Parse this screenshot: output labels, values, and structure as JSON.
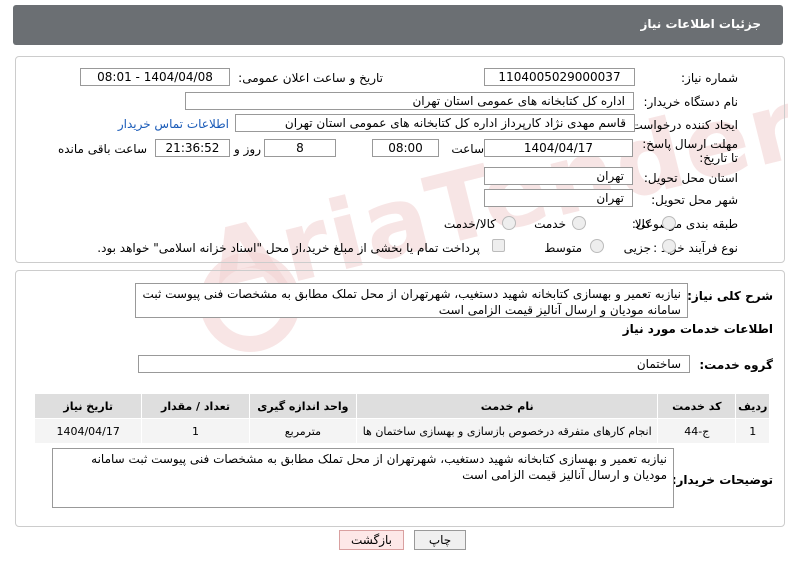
{
  "header": {
    "title": "جزئیات اطلاعات نیاز"
  },
  "form": {
    "need_number_label": "شماره نیاز:",
    "need_number": "1104005029000037",
    "announce_datetime_label": "تاریخ و ساعت اعلان عمومی:",
    "announce_datetime": "1404/04/08 - 08:01",
    "buyer_org_label": "نام دستگاه خریدار:",
    "buyer_org": "اداره کل کتابخانه های عمومی استان تهران",
    "requester_label": "ایجاد کننده درخواست:",
    "requester": "قاسم مهدی نژاد کارپرداز اداره کل کتابخانه های عمومی استان تهران",
    "buyer_contact_link": "اطلاعات تماس خریدار",
    "deadline_label": "مهلت ارسال پاسخ: تا تاریخ:",
    "deadline_date": "1404/04/17",
    "time_label": "ساعت",
    "deadline_time": "08:00",
    "days_value": "8",
    "days_label": "روز و",
    "remaining_time": "21:36:52",
    "remaining_label": "ساعت باقی مانده",
    "province_label": "استان محل تحویل:",
    "province": "تهران",
    "city_label": "شهر محل تحویل:",
    "city": "تهران",
    "category_label": "طبقه بندی موضوعی:",
    "category_options": [
      "کالا",
      "خدمت",
      "کالا/خدمت"
    ],
    "process_label": "نوع فرآیند خرید :",
    "process_options": [
      "جزیی",
      "متوسط"
    ],
    "payment_note": "پرداخت تمام یا بخشی از مبلغ خرید،از محل \"اسناد خزانه اسلامی\" خواهد بود."
  },
  "details": {
    "summary_label": "شرح کلی نیاز:",
    "summary": "نیازبه تعمیر و بهسازی کتابخانه شهید دستغیب، شهرتهران از محل تملک مطابق به مشخصات فنی پیوست ثبت سامانه مودیان و ارسال آنالیز قیمت الزامی است",
    "services_title": "اطلاعات خدمات مورد نیاز",
    "service_group_label": "گروه خدمت:",
    "service_group": "ساختمان",
    "table": {
      "headers": [
        "ردیف",
        "کد خدمت",
        "نام خدمت",
        "واحد اندازه گیری",
        "تعداد / مقدار",
        "تاریخ نیاز"
      ],
      "rows": [
        [
          "1",
          "ج-44",
          "انجام کارهای متفرقه درخصوص بازسازی و بهسازی ساختمان ها",
          "مترمربع",
          "1",
          "1404/04/17"
        ]
      ]
    },
    "buyer_notes_label": "توضیحات خریدار:",
    "buyer_notes": "نیازبه تعمیر و بهسازی کتابخانه شهید دستغیب، شهرتهران از محل تملک مطابق به مشخصات فنی پیوست ثبت سامانه مودیان و ارسال آنالیز قیمت الزامی است"
  },
  "buttons": {
    "print": "چاپ",
    "back": "بازگشت"
  },
  "watermark": "AriaTender.net"
}
